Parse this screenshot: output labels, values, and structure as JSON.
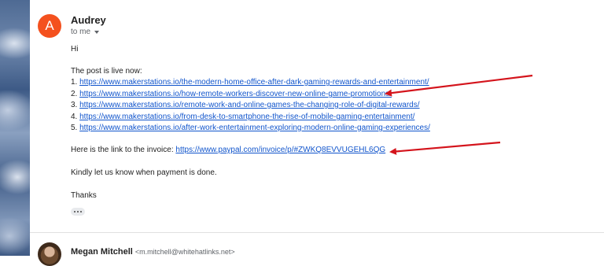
{
  "message": {
    "sender_initial": "A",
    "sender_name": "Audrey",
    "to_label": "to me",
    "greeting": "Hi",
    "intro": "The post is live now:",
    "links": [
      {
        "num": "1.",
        "url": "https://www.makerstations.io/the-modern-home-office-after-dark-gaming-rewards-and-entertainment/"
      },
      {
        "num": "2.",
        "url": "https://www.makerstations.io/how-remote-workers-discover-new-online-game-promotions/"
      },
      {
        "num": "3.",
        "url": "https://www.makerstations.io/remote-work-and-online-games-the-changing-role-of-digital-rewards/"
      },
      {
        "num": "4.",
        "url": "https://www.makerstations.io/from-desk-to-smartphone-the-rise-of-mobile-gaming-entertainment/"
      },
      {
        "num": "5.",
        "url": "https://www.makerstations.io/after-work-entertainment-exploring-modern-online-gaming-experiences/"
      }
    ],
    "invoice_prefix": "Here is the link to the invoice: ",
    "invoice_url": "https://www.paypal.com/invoice/p/#ZWKQ8EVVUGEHL6QG",
    "payment_note": "Kindly let us know when payment is done.",
    "signoff": "Thanks"
  },
  "next_message": {
    "sender_name": "Megan Mitchell",
    "sender_email": "<m.mitchell@whitehatlinks.net>"
  },
  "colors": {
    "avatar": "#f4511e",
    "link": "#1155cc",
    "annotation_arrow": "#d4141c"
  }
}
